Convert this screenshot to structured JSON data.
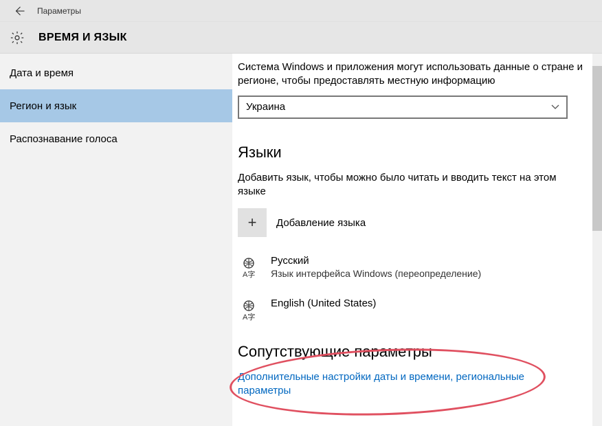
{
  "window": {
    "title": "Параметры"
  },
  "header": {
    "section": "ВРЕМЯ И ЯЗЫК"
  },
  "sidebar": {
    "items": [
      {
        "label": "Дата и время",
        "selected": false
      },
      {
        "label": "Регион и язык",
        "selected": true
      },
      {
        "label": "Распознавание голоса",
        "selected": false
      }
    ]
  },
  "region": {
    "description": "Система Windows и приложения могут использовать данные о стране и регионе, чтобы предоставлять местную информацию",
    "selected": "Украина"
  },
  "languages": {
    "heading": "Языки",
    "description": "Добавить язык, чтобы можно было читать и вводить текст на этом языке",
    "add_label": "Добавление языка",
    "list": [
      {
        "name": "Русский",
        "sub": "Язык интерфейса Windows (переопределение)"
      },
      {
        "name": "English (United States)",
        "sub": ""
      }
    ]
  },
  "related": {
    "heading": "Сопутствующие параметры",
    "link": "Дополнительные настройки даты и времени, региональные параметры"
  }
}
